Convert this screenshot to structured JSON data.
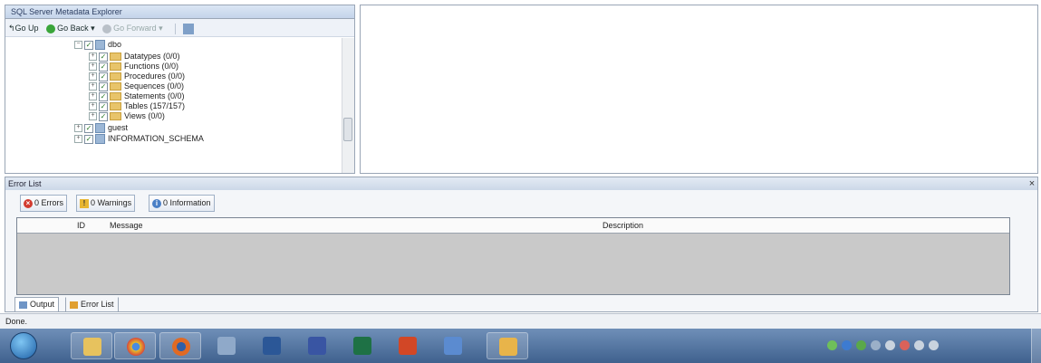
{
  "explorer": {
    "title": "SQL Server Metadata Explorer",
    "toolbar": {
      "go_up": "Go Up",
      "go_back": "Go Back",
      "go_forward": "Go Forward"
    },
    "tree": [
      {
        "label": "dbo",
        "type": "schema",
        "expander": "−"
      },
      {
        "label": "Datatypes (0/0)",
        "type": "folder",
        "expander": "+"
      },
      {
        "label": "Functions (0/0)",
        "type": "folder",
        "expander": "+"
      },
      {
        "label": "Procedures (0/0)",
        "type": "folder",
        "expander": "+"
      },
      {
        "label": "Sequences (0/0)",
        "type": "folder",
        "expander": "+"
      },
      {
        "label": "Statements (0/0)",
        "type": "folder",
        "expander": "+"
      },
      {
        "label": "Tables (157/157)",
        "type": "folder",
        "expander": "+"
      },
      {
        "label": "Views (0/0)",
        "type": "folder",
        "expander": "+"
      },
      {
        "label": "guest",
        "type": "schema",
        "expander": "+"
      },
      {
        "label": "INFORMATION_SCHEMA",
        "type": "schema",
        "expander": "+"
      }
    ]
  },
  "error_list": {
    "title": "Error List",
    "close_glyph": "×",
    "filters": {
      "errors": "0 Errors",
      "warnings": "0 Warnings",
      "information": "0 Information"
    },
    "columns": {
      "id": "ID",
      "message": "Message",
      "description": "Description"
    },
    "tabs": {
      "output": "Output",
      "error_list": "Error List"
    }
  },
  "status": {
    "text": "Done."
  },
  "taskbar": {
    "apps": [
      "file-explorer",
      "chrome",
      "firefox",
      "app-icon",
      "word",
      "visio",
      "excel",
      "powerpoint",
      "app-icon",
      "sql-migration-assistant"
    ],
    "colors": {
      "taskbar": "#4a6b96",
      "error": "#d23b2f",
      "warning": "#e8b630",
      "info": "#4a7fc6",
      "folder": "#e8c46a"
    }
  }
}
